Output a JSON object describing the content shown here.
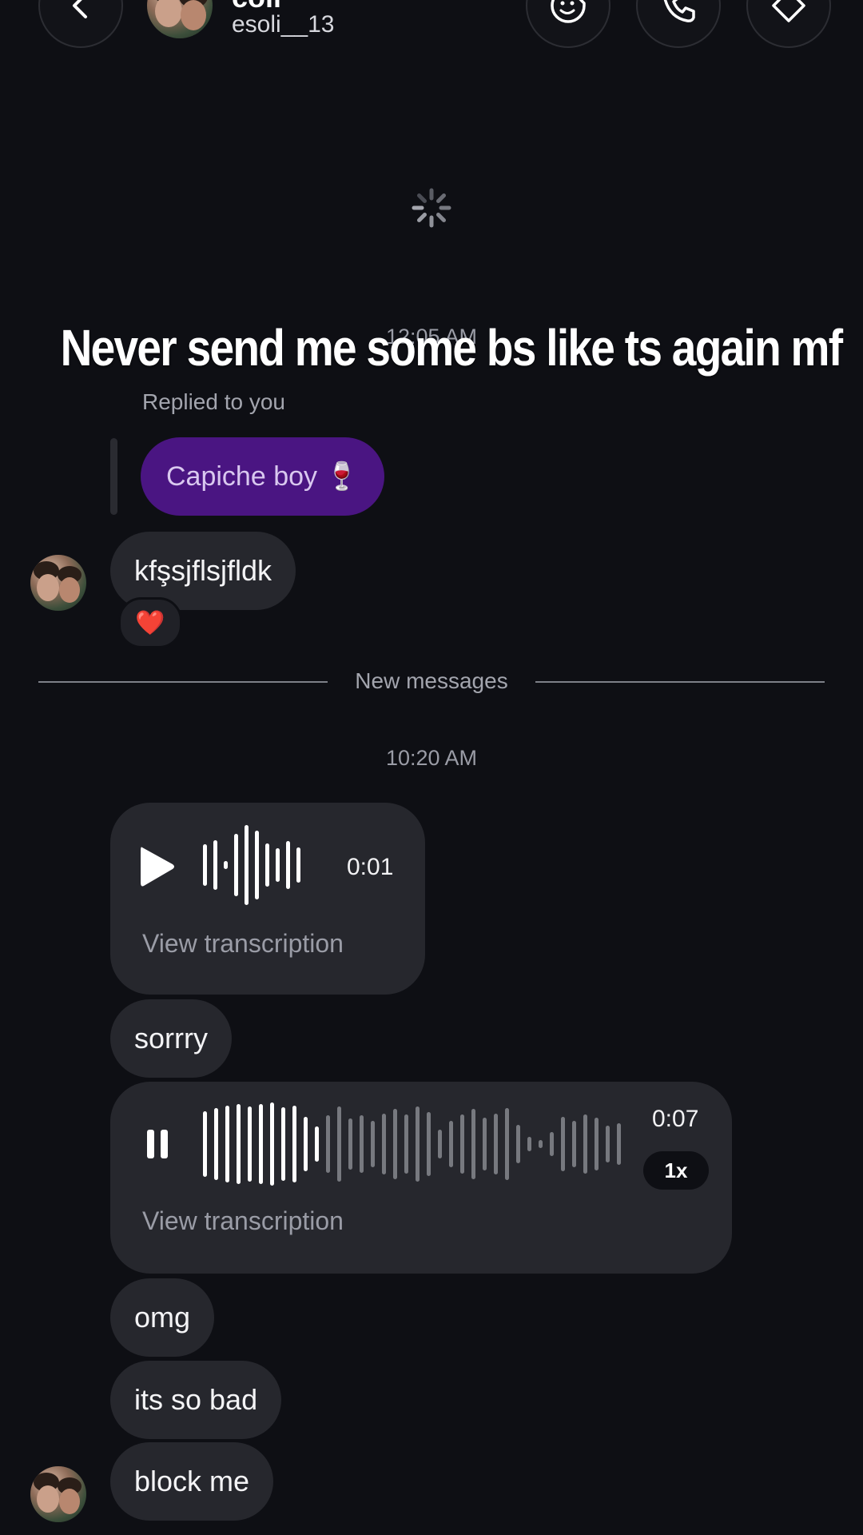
{
  "header": {
    "name": "coli",
    "username": "esoli__13"
  },
  "timestamps": {
    "first": "12:05 AM",
    "second": "10:20 AM"
  },
  "overlay_caption": "Never send me some bs like ts again mf",
  "reply": {
    "label": "Replied to you",
    "quoted_message": "Capiche boy 🍷"
  },
  "messages": [
    {
      "text": "kfşsjflsjfldk",
      "reaction": "❤️"
    },
    {
      "text": "sorrry"
    },
    {
      "text": "omg"
    },
    {
      "text": "its so bad"
    },
    {
      "text": "block me"
    }
  ],
  "divider": {
    "label": "New messages"
  },
  "voice_messages": [
    {
      "duration": "0:01",
      "state": "paused",
      "transcription_label": "View transcription"
    },
    {
      "duration": "0:07",
      "state": "playing",
      "speed": "1x",
      "progress": 0.18,
      "transcription_label": "View transcription"
    }
  ],
  "icons": {
    "back": "chevron-left-icon",
    "sticker": "sticker-face-icon",
    "call": "phone-icon",
    "tag": "tag-icon",
    "loader": "loading-spinner-icon",
    "heart": "heart-reaction-icon",
    "play": "play-icon",
    "pause": "pause-icon"
  },
  "colors": {
    "background": "#0e0f14",
    "bubble": "#26272d",
    "reply_bubble": "#4a1582"
  }
}
